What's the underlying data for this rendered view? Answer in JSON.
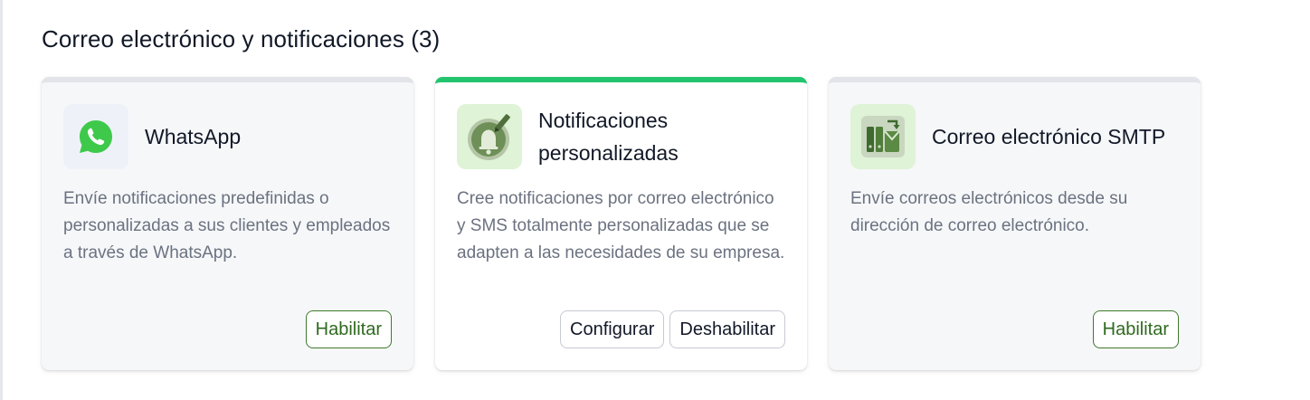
{
  "section": {
    "title": "Correo electrónico y notificaciones (3)"
  },
  "cards": [
    {
      "name": "WhatsApp",
      "icon": "whatsapp-icon",
      "description": "Envíe notificaciones predefinidas o personalizadas a sus clientes y empleados a través de WhatsApp.",
      "state": "inactive",
      "buttons": {
        "enable": "Habilitar"
      }
    },
    {
      "name_line1": "Notificaciones",
      "name_line2": "personalizadas",
      "icon": "bell-edit-icon",
      "description": "Cree notificaciones por correo electrónico y SMS totalmente personalizadas que se adapten a las necesidades de su empresa.",
      "state": "active",
      "buttons": {
        "configure": "Configurar",
        "disable": "Deshabilitar"
      }
    },
    {
      "name": "Correo electrónico SMTP",
      "icon": "smtp-mail-icon",
      "description": "Envíe correos electrónicos desde su dirección de correo electrónico.",
      "state": "inactive",
      "buttons": {
        "enable": "Habilitar"
      }
    }
  ],
  "colors": {
    "active_accent": "#22c56e",
    "inactive_accent": "#e2e4e9",
    "enable_button": "#3f7a2c",
    "whatsapp_green": "#3ec94b"
  }
}
